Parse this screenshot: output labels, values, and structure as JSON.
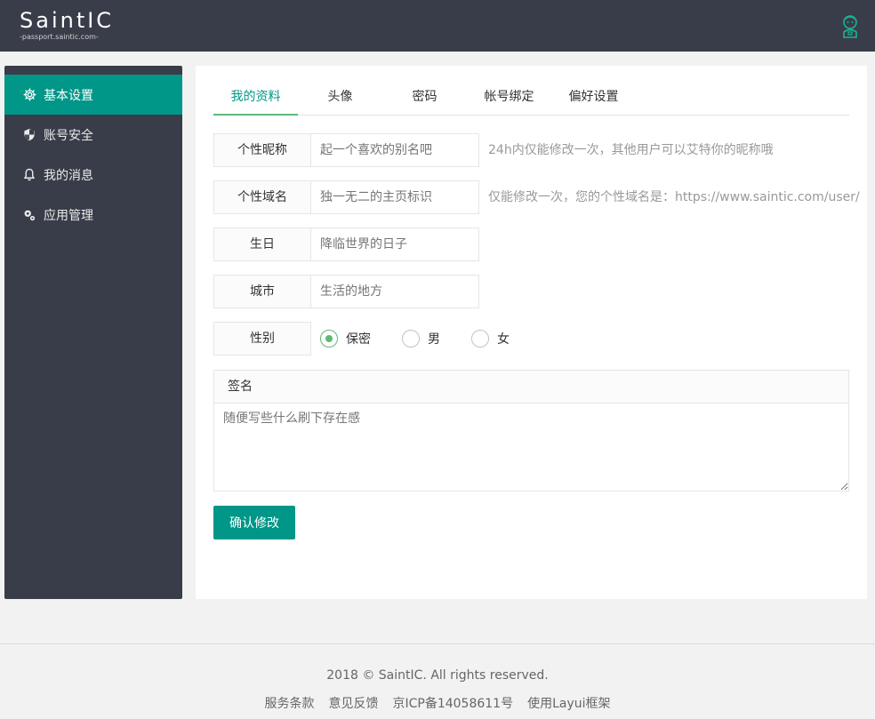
{
  "header": {
    "logo_text": "SaintIC",
    "logo_subtext": "-passport.saintic.com-"
  },
  "sidebar": {
    "items": [
      {
        "label": "基本设置",
        "icon": "gear-icon",
        "active": true
      },
      {
        "label": "账号安全",
        "icon": "shield-icon",
        "active": false
      },
      {
        "label": "我的消息",
        "icon": "bell-icon",
        "active": false
      },
      {
        "label": "应用管理",
        "icon": "apps-icon",
        "active": false
      }
    ]
  },
  "tabs": [
    {
      "label": "我的资料",
      "active": true
    },
    {
      "label": "头像",
      "active": false
    },
    {
      "label": "密码",
      "active": false
    },
    {
      "label": "帐号绑定",
      "active": false
    },
    {
      "label": "偏好设置",
      "active": false
    }
  ],
  "form": {
    "nickname": {
      "label": "个性昵称",
      "placeholder": "起一个喜欢的别名吧",
      "aux": "24h内仅能修改一次，其他用户可以艾特你的昵称哦"
    },
    "domain": {
      "label": "个性域名",
      "placeholder": "独一无二的主页标识",
      "aux": "仅能修改一次，您的个性域名是：https://www.saintic.com/user/"
    },
    "birthday": {
      "label": "生日",
      "placeholder": "降临世界的日子"
    },
    "city": {
      "label": "城市",
      "placeholder": "生活的地方"
    },
    "gender": {
      "label": "性别",
      "options": [
        {
          "label": "保密",
          "checked": true
        },
        {
          "label": "男",
          "checked": false
        },
        {
          "label": "女",
          "checked": false
        }
      ]
    },
    "signature": {
      "label": "签名",
      "placeholder": "随便写些什么刷下存在感"
    },
    "submit_label": "确认修改"
  },
  "footer": {
    "copyright": "2018 © SaintIC. All rights reserved.",
    "links": [
      "服务条款",
      "意见反馈",
      "京ICP备14058611号",
      "使用Layui框架"
    ]
  },
  "colors": {
    "header_bg": "#393d49",
    "accent": "#009688",
    "radio_checked": "#5fb878"
  }
}
